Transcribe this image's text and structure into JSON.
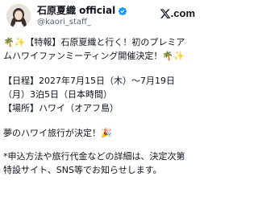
{
  "author": {
    "display_name": "石原夏織 official",
    "handle": "@kaori_staff_"
  },
  "brand": {
    "logo_text": ".com"
  },
  "post": {
    "line1": "🌴✨【特報】石原夏織と行く！初のプレミア",
    "line2": "ムハワイファンミーティング開催決定！🌴✨",
    "line3": "【日程】2027年7月15日（木）～7月19日",
    "line4": "（月）3泊5日（日本時間）",
    "line5": "【場所】ハワイ（オアフ島）",
    "line6": "夢のハワイ旅行が決定！🎉",
    "line7": "*申込方法や旅行代金などの詳細は、決定次第",
    "line8": "特設サイト、SNS等でお知らせします。"
  },
  "icons": {
    "verified": "verified-badge-icon",
    "x": "x-logo-icon",
    "avatar": "avatar-photo"
  },
  "colors": {
    "text": "#0f1419",
    "secondary": "#536471",
    "verified": "#1d9bf0"
  }
}
